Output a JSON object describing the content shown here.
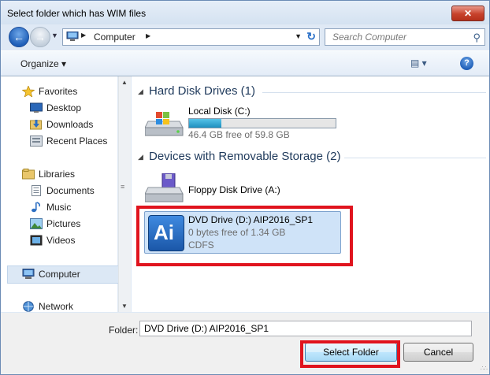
{
  "window": {
    "title": "Select folder which has WIM files",
    "close_label": "✕"
  },
  "address": {
    "location": "Computer"
  },
  "search": {
    "placeholder": "Search Computer"
  },
  "toolbar": {
    "organize_label": "Organize ▾"
  },
  "sidebar": {
    "items": [
      {
        "label": "Favorites",
        "icon": "star-icon"
      },
      {
        "label": "Desktop",
        "icon": "desktop-icon"
      },
      {
        "label": "Downloads",
        "icon": "downloads-icon"
      },
      {
        "label": "Recent Places",
        "icon": "recent-places-icon"
      },
      {
        "label": "Libraries",
        "icon": "libraries-icon"
      },
      {
        "label": "Documents",
        "icon": "documents-icon"
      },
      {
        "label": "Music",
        "icon": "music-icon"
      },
      {
        "label": "Pictures",
        "icon": "pictures-icon"
      },
      {
        "label": "Videos",
        "icon": "videos-icon"
      },
      {
        "label": "Computer",
        "icon": "computer-icon"
      },
      {
        "label": "Network",
        "icon": "network-icon"
      }
    ]
  },
  "groups": {
    "hdd": {
      "title": "Hard Disk Drives (1)",
      "drive": {
        "name": "Local Disk (C:)",
        "free": "46.4 GB free of 59.8 GB",
        "used_fraction": 0.22
      }
    },
    "removable": {
      "title": "Devices with Removable Storage (2)",
      "floppy": {
        "name": "Floppy Disk Drive (A:)"
      },
      "dvd": {
        "name": "DVD Drive (D:) AIP2016_SP1",
        "free": "0 bytes free of 1.34 GB",
        "fs": "CDFS",
        "badge": "Ai"
      }
    }
  },
  "footer": {
    "folder_label": "Folder:",
    "folder_value": "DVD Drive (D:) AIP2016_SP1",
    "select_label": "Select Folder",
    "cancel_label": "Cancel"
  },
  "colors": {
    "highlight_red": "#e0141e",
    "selection_blue": "#cfe3f8"
  }
}
